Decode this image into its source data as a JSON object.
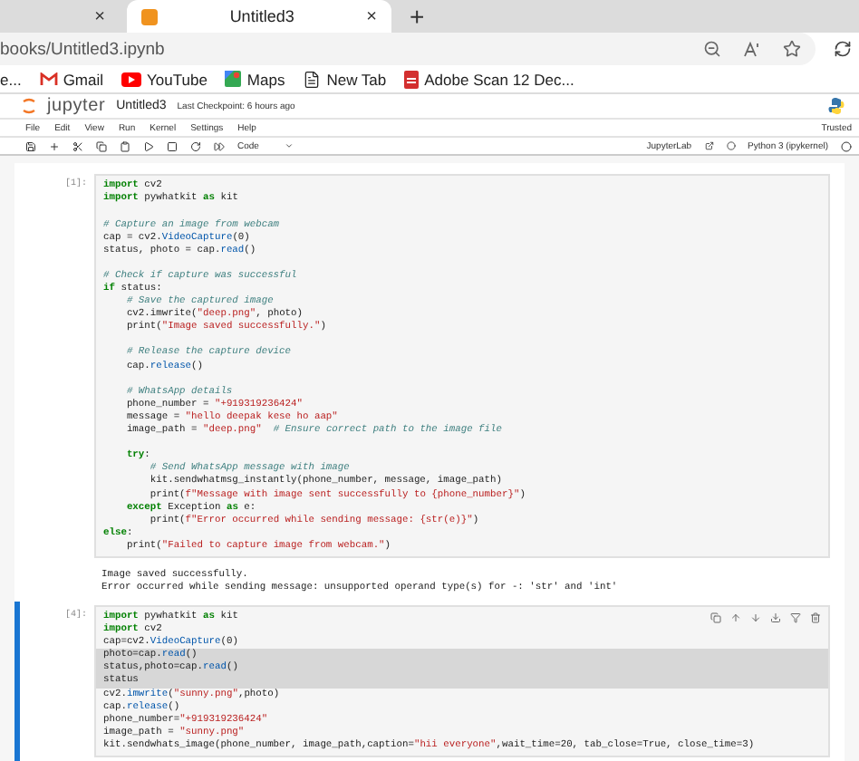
{
  "browser": {
    "tabs": [
      {
        "selected": false,
        "close": "×"
      },
      {
        "title": "Untitled3",
        "selected": true,
        "close": "×"
      }
    ],
    "new_tab": "+",
    "address": "books/Untitled3.ipynb",
    "bookmarks": [
      "e...",
      "Gmail",
      "YouTube",
      "Maps",
      "New Tab",
      "Adobe Scan 12 Dec..."
    ]
  },
  "jupyter": {
    "logo": "jupyter",
    "notebook": "Untitled3",
    "checkpoint": "Last Checkpoint: 6 hours ago",
    "menu": [
      "File",
      "Edit",
      "View",
      "Run",
      "Kernel",
      "Settings",
      "Help"
    ],
    "trusted": "Trusted",
    "cell_type": "Code",
    "lab_link": "JupyterLab",
    "kernel": "Python 3 (ipykernel)"
  },
  "cells": [
    {
      "prompt": "[1]:",
      "active": false,
      "lines": [
        {
          "kind": "code",
          "parts": [
            {
              "kind": "keyword",
              "text": "import"
            },
            {
              "kind": "plain",
              "text": " cv2"
            }
          ]
        },
        {
          "kind": "code",
          "parts": [
            {
              "kind": "keyword",
              "text": "import"
            },
            {
              "kind": "plain",
              "text": " pywhatkit "
            },
            {
              "kind": "keyword",
              "text": "as"
            },
            {
              "kind": "plain",
              "text": " kit"
            }
          ]
        },
        {
          "kind": "blank"
        },
        {
          "kind": "code",
          "parts": [
            {
              "kind": "comment",
              "text": "# Capture an image from webcam"
            }
          ]
        },
        {
          "kind": "code",
          "parts": [
            {
              "kind": "plain",
              "text": "cap = cv2."
            },
            {
              "kind": "call",
              "text": "VideoCapture"
            },
            {
              "kind": "plain",
              "text": "(0)"
            }
          ]
        },
        {
          "kind": "code",
          "parts": [
            {
              "kind": "plain",
              "text": "status, photo = cap."
            },
            {
              "kind": "call",
              "text": "read"
            },
            {
              "kind": "plain",
              "text": "()"
            }
          ]
        },
        {
          "kind": "blank"
        },
        {
          "kind": "code",
          "parts": [
            {
              "kind": "comment",
              "text": "# Check if capture was successful"
            }
          ]
        },
        {
          "kind": "code",
          "parts": [
            {
              "kind": "keyword",
              "text": "if"
            },
            {
              "kind": "plain",
              "text": " status:"
            }
          ]
        },
        {
          "kind": "code",
          "parts": [
            {
              "kind": "comment",
              "text": "    # Save the captured image"
            }
          ]
        },
        {
          "kind": "code",
          "parts": [
            {
              "kind": "plain",
              "text": "    cv2.imwrite("
            },
            {
              "kind": "string",
              "text": "\"deep.png\""
            },
            {
              "kind": "plain",
              "text": ", photo)"
            }
          ]
        },
        {
          "kind": "code",
          "parts": [
            {
              "kind": "plain",
              "text": "    print("
            },
            {
              "kind": "string",
              "text": "\"Image saved successfully.\""
            },
            {
              "kind": "plain",
              "text": ")"
            }
          ]
        },
        {
          "kind": "blank"
        },
        {
          "kind": "code",
          "parts": [
            {
              "kind": "comment",
              "text": "    # Release the capture device"
            }
          ]
        },
        {
          "kind": "code",
          "parts": [
            {
              "kind": "plain",
              "text": "    cap."
            },
            {
              "kind": "call",
              "text": "release"
            },
            {
              "kind": "plain",
              "text": "()"
            }
          ]
        },
        {
          "kind": "blank"
        },
        {
          "kind": "code",
          "parts": [
            {
              "kind": "comment",
              "text": "    # WhatsApp details"
            }
          ]
        },
        {
          "kind": "code",
          "parts": [
            {
              "kind": "plain",
              "text": "    phone_number = "
            },
            {
              "kind": "string",
              "text": "\"+919319236424\""
            }
          ]
        },
        {
          "kind": "code",
          "parts": [
            {
              "kind": "plain",
              "text": "    message = "
            },
            {
              "kind": "string",
              "text": "\"hello deepak kese ho aap\""
            }
          ]
        },
        {
          "kind": "code",
          "parts": [
            {
              "kind": "plain",
              "text": "    image_path = "
            },
            {
              "kind": "string",
              "text": "\"deep.png\""
            },
            {
              "kind": "comment",
              "text": "  # Ensure correct path to the image file"
            }
          ]
        },
        {
          "kind": "blank"
        },
        {
          "kind": "code",
          "parts": [
            {
              "kind": "keyword",
              "text": "    try"
            },
            {
              "kind": "plain",
              "text": ":"
            }
          ]
        },
        {
          "kind": "code",
          "parts": [
            {
              "kind": "comment",
              "text": "        # Send WhatsApp message with image"
            }
          ]
        },
        {
          "kind": "code",
          "parts": [
            {
              "kind": "plain",
              "text": "        kit.sendwhatmsg_instantly(phone_number, message, image_path)"
            }
          ]
        },
        {
          "kind": "code",
          "parts": [
            {
              "kind": "plain",
              "text": "        print("
            },
            {
              "kind": "string",
              "text": "f\"Message with image sent successfully to {phone_number}\""
            },
            {
              "kind": "plain",
              "text": ")"
            }
          ]
        },
        {
          "kind": "code",
          "parts": [
            {
              "kind": "keyword",
              "text": "    except"
            },
            {
              "kind": "plain",
              "text": " Exception "
            },
            {
              "kind": "keyword",
              "text": "as"
            },
            {
              "kind": "plain",
              "text": " e:"
            }
          ]
        },
        {
          "kind": "code",
          "parts": [
            {
              "kind": "plain",
              "text": "        print("
            },
            {
              "kind": "string",
              "text": "f\"Error occurred while sending message: {str(e)}\""
            },
            {
              "kind": "plain",
              "text": ")"
            }
          ]
        },
        {
          "kind": "code",
          "parts": [
            {
              "kind": "keyword",
              "text": "else"
            },
            {
              "kind": "plain",
              "text": ":"
            }
          ]
        },
        {
          "kind": "code",
          "parts": [
            {
              "kind": "plain",
              "text": "    print("
            },
            {
              "kind": "string",
              "text": "\"Failed to capture image from webcam.\""
            },
            {
              "kind": "plain",
              "text": ")"
            }
          ]
        }
      ],
      "output": [
        "Image saved successfully.",
        "Error occurred while sending message: unsupported operand type(s) for -: 'str' and 'int'"
      ]
    },
    {
      "prompt": "[4]:",
      "active": true,
      "lines": [
        {
          "kind": "code",
          "highlighted": false,
          "parts": [
            {
              "kind": "keyword",
              "text": "import"
            },
            {
              "kind": "plain",
              "text": " pywhatkit "
            },
            {
              "kind": "keyword",
              "text": "as"
            },
            {
              "kind": "plain",
              "text": " kit"
            }
          ]
        },
        {
          "kind": "code",
          "highlighted": false,
          "parts": [
            {
              "kind": "keyword",
              "text": "import"
            },
            {
              "kind": "plain",
              "text": " cv2"
            }
          ]
        },
        {
          "kind": "code",
          "highlighted": false,
          "parts": [
            {
              "kind": "plain",
              "text": "cap=cv2."
            },
            {
              "kind": "call",
              "text": "VideoCapture"
            },
            {
              "kind": "plain",
              "text": "(0)"
            }
          ]
        },
        {
          "kind": "code",
          "highlighted": true,
          "parts": [
            {
              "kind": "plain",
              "text": "photo=cap."
            },
            {
              "kind": "call",
              "text": "read"
            },
            {
              "kind": "plain",
              "text": "()"
            }
          ]
        },
        {
          "kind": "code",
          "highlighted": true,
          "parts": [
            {
              "kind": "plain",
              "text": "status,photo=cap."
            },
            {
              "kind": "call",
              "text": "read"
            },
            {
              "kind": "plain",
              "text": "()"
            }
          ]
        },
        {
          "kind": "code",
          "highlighted": true,
          "parts": [
            {
              "kind": "plain",
              "text": "status"
            }
          ]
        },
        {
          "kind": "code",
          "highlighted": false,
          "parts": [
            {
              "kind": "plain",
              "text": "cv2."
            },
            {
              "kind": "call",
              "text": "imwrite"
            },
            {
              "kind": "plain",
              "text": "("
            },
            {
              "kind": "string",
              "text": "\"sunny.png\""
            },
            {
              "kind": "plain",
              "text": ",photo)"
            }
          ]
        },
        {
          "kind": "code",
          "highlighted": false,
          "parts": [
            {
              "kind": "plain",
              "text": "cap."
            },
            {
              "kind": "call",
              "text": "release"
            },
            {
              "kind": "plain",
              "text": "()"
            }
          ]
        },
        {
          "kind": "code",
          "highlighted": false,
          "parts": [
            {
              "kind": "plain",
              "text": "phone_number="
            },
            {
              "kind": "string",
              "text": "\"+919319236424\""
            }
          ]
        },
        {
          "kind": "code",
          "highlighted": false,
          "parts": [
            {
              "kind": "plain",
              "text": "image_path = "
            },
            {
              "kind": "string",
              "text": "\"sunny.png\""
            }
          ]
        },
        {
          "kind": "code",
          "highlighted": false,
          "parts": [
            {
              "kind": "plain",
              "text": "kit.sendwhats_image(phone_number, image_path,caption="
            },
            {
              "kind": "string",
              "text": "\"hii everyone\""
            },
            {
              "kind": "plain",
              "text": ",wait_time=20, tab_close=True, close_time=3)"
            }
          ]
        }
      ]
    }
  ]
}
